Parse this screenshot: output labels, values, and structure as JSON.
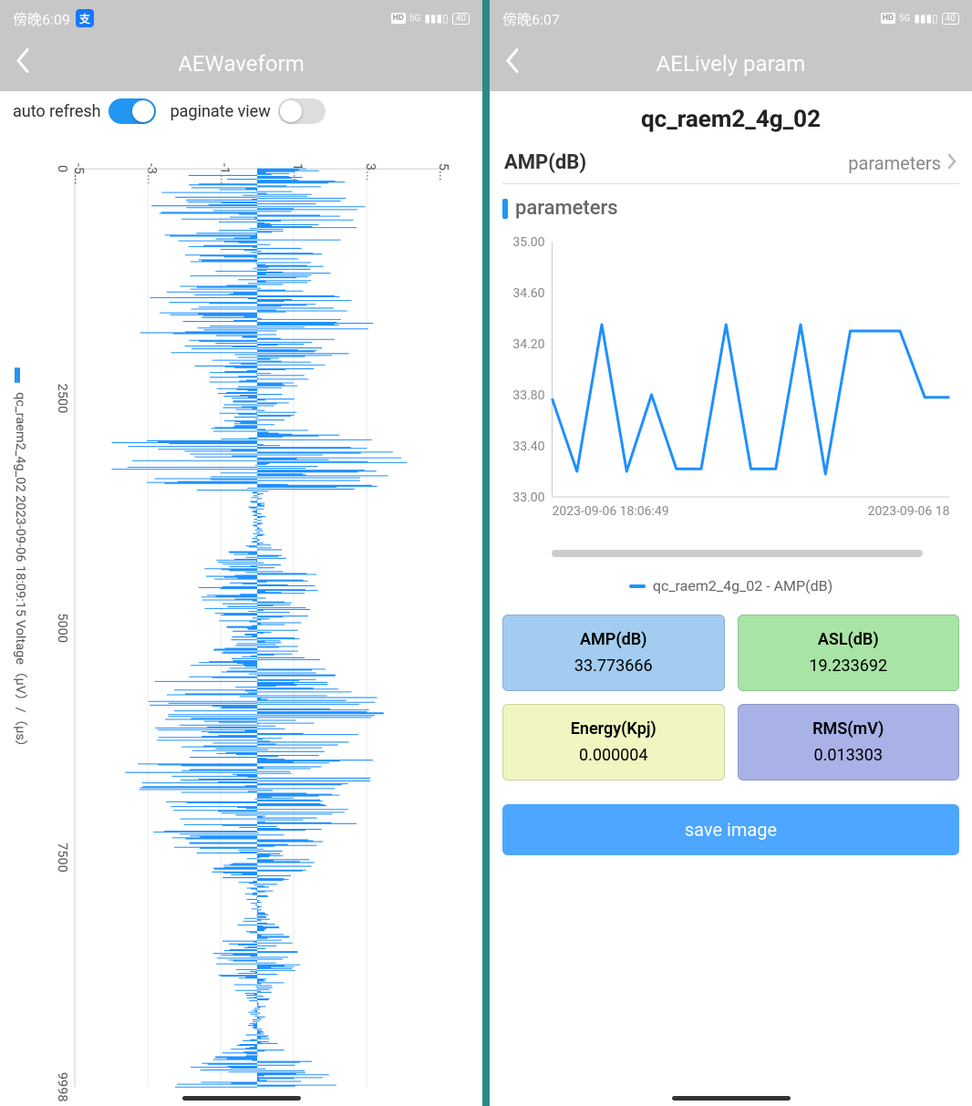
{
  "left": {
    "status": {
      "time": "傍晚6:09",
      "net": "5G",
      "batt": "40"
    },
    "nav_title": "AEWaveform",
    "toggles": {
      "auto_refresh_label": "auto refresh",
      "auto_refresh_on": true,
      "paginate_label": "paginate view",
      "paginate_on": false
    },
    "waveform": {
      "legend": "qc_raem2_4g_02 2023-09-06 18:09:15 Voltage（μV）/（μs）",
      "x_ticks": [
        "-5...",
        "-3...",
        "-1...",
        "1...",
        "3...",
        "5..."
      ],
      "y_ticks": [
        "0",
        "2500",
        "5000",
        "7500",
        "9998"
      ]
    }
  },
  "right": {
    "status": {
      "time": "傍晚6:07",
      "net": "5G",
      "batt": "40"
    },
    "nav_title": "AELively param",
    "device": "qc_raem2_4g_02",
    "selected_metric": "AMP(dB)",
    "selector_label": "parameters",
    "section_title": "parameters",
    "chart_legend": "qc_raem2_4g_02 - AMP(dB)",
    "chart_x_left": "2023-09-06 18:06:49",
    "chart_x_right": "2023-09-06 18",
    "save_button": "save image",
    "cards": [
      {
        "k": "AMP(dB)",
        "v": "33.773666",
        "cls": "c-blue"
      },
      {
        "k": "ASL(dB)",
        "v": "19.233692",
        "cls": "c-green"
      },
      {
        "k": "Energy(Kpj)",
        "v": "0.000004",
        "cls": "c-yellow"
      },
      {
        "k": "RMS(mV)",
        "v": "0.013303",
        "cls": "c-indigo"
      }
    ]
  },
  "chart_data": {
    "type": "line",
    "title": "parameters",
    "ylabel": "AMP(dB)",
    "ylim": [
      33.0,
      35.0
    ],
    "y_ticks": [
      33.0,
      33.4,
      33.8,
      34.2,
      34.6,
      35.0
    ],
    "x_label_left": "2023-09-06 18:06:49",
    "x_label_right": "2023-09-06 18",
    "series": [
      {
        "name": "qc_raem2_4g_02 - AMP(dB)",
        "values": [
          33.77,
          33.2,
          34.35,
          33.2,
          33.8,
          33.22,
          33.22,
          34.35,
          33.22,
          33.22,
          34.35,
          33.18,
          34.3,
          34.3,
          34.3,
          33.78,
          33.78
        ]
      }
    ]
  }
}
